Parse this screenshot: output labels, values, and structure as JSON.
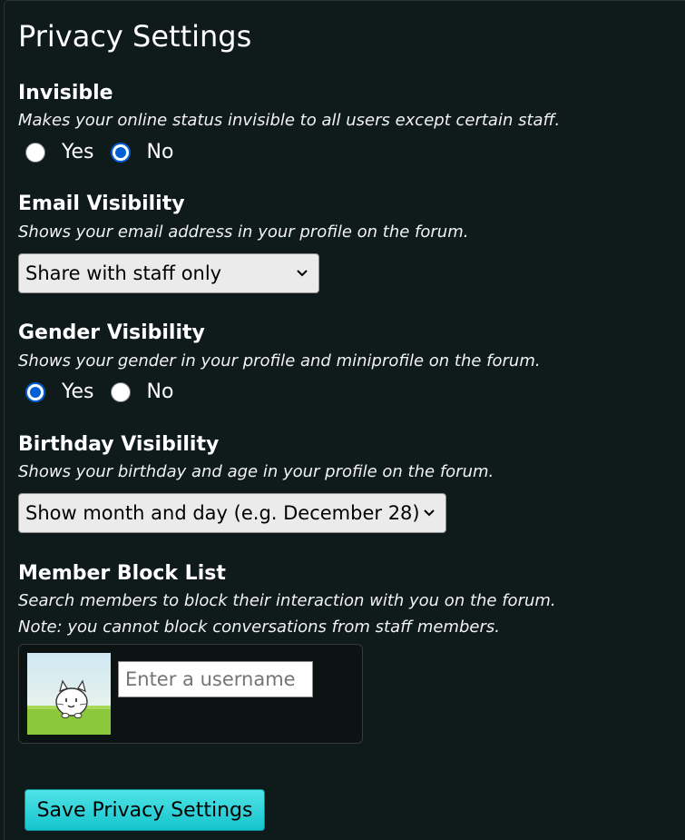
{
  "page": {
    "title": "Privacy Settings"
  },
  "invisible": {
    "title": "Invisible",
    "description": "Makes your online status invisible to all users except certain staff.",
    "options": [
      "Yes",
      "No"
    ],
    "selected": "No"
  },
  "email_visibility": {
    "title": "Email Visibility",
    "description": "Shows your email address in your profile on the forum.",
    "selected_value": "Share with staff only"
  },
  "gender_visibility": {
    "title": "Gender Visibility",
    "description": "Shows your gender in your profile and miniprofile on the forum.",
    "options": [
      "Yes",
      "No"
    ],
    "selected": "Yes"
  },
  "birthday_visibility": {
    "title": "Birthday Visibility",
    "description": "Shows your birthday and age in your profile on the forum.",
    "selected_value": "Show month and day (e.g. December 28)"
  },
  "block_list": {
    "title": "Member Block List",
    "description": "Search members to block their interaction with you on the forum.",
    "note": "Note: you cannot block conversations from staff members.",
    "input_placeholder": "Enter a username"
  },
  "actions": {
    "save_label": "Save Privacy Settings"
  },
  "colors": {
    "background": "#0f1a1b",
    "radio_checked": "#005fd4",
    "button_accent": "#16c4cc"
  },
  "icons": {
    "select_indicator": "chevron-down-icon",
    "avatar": "cat-avatar-icon"
  }
}
